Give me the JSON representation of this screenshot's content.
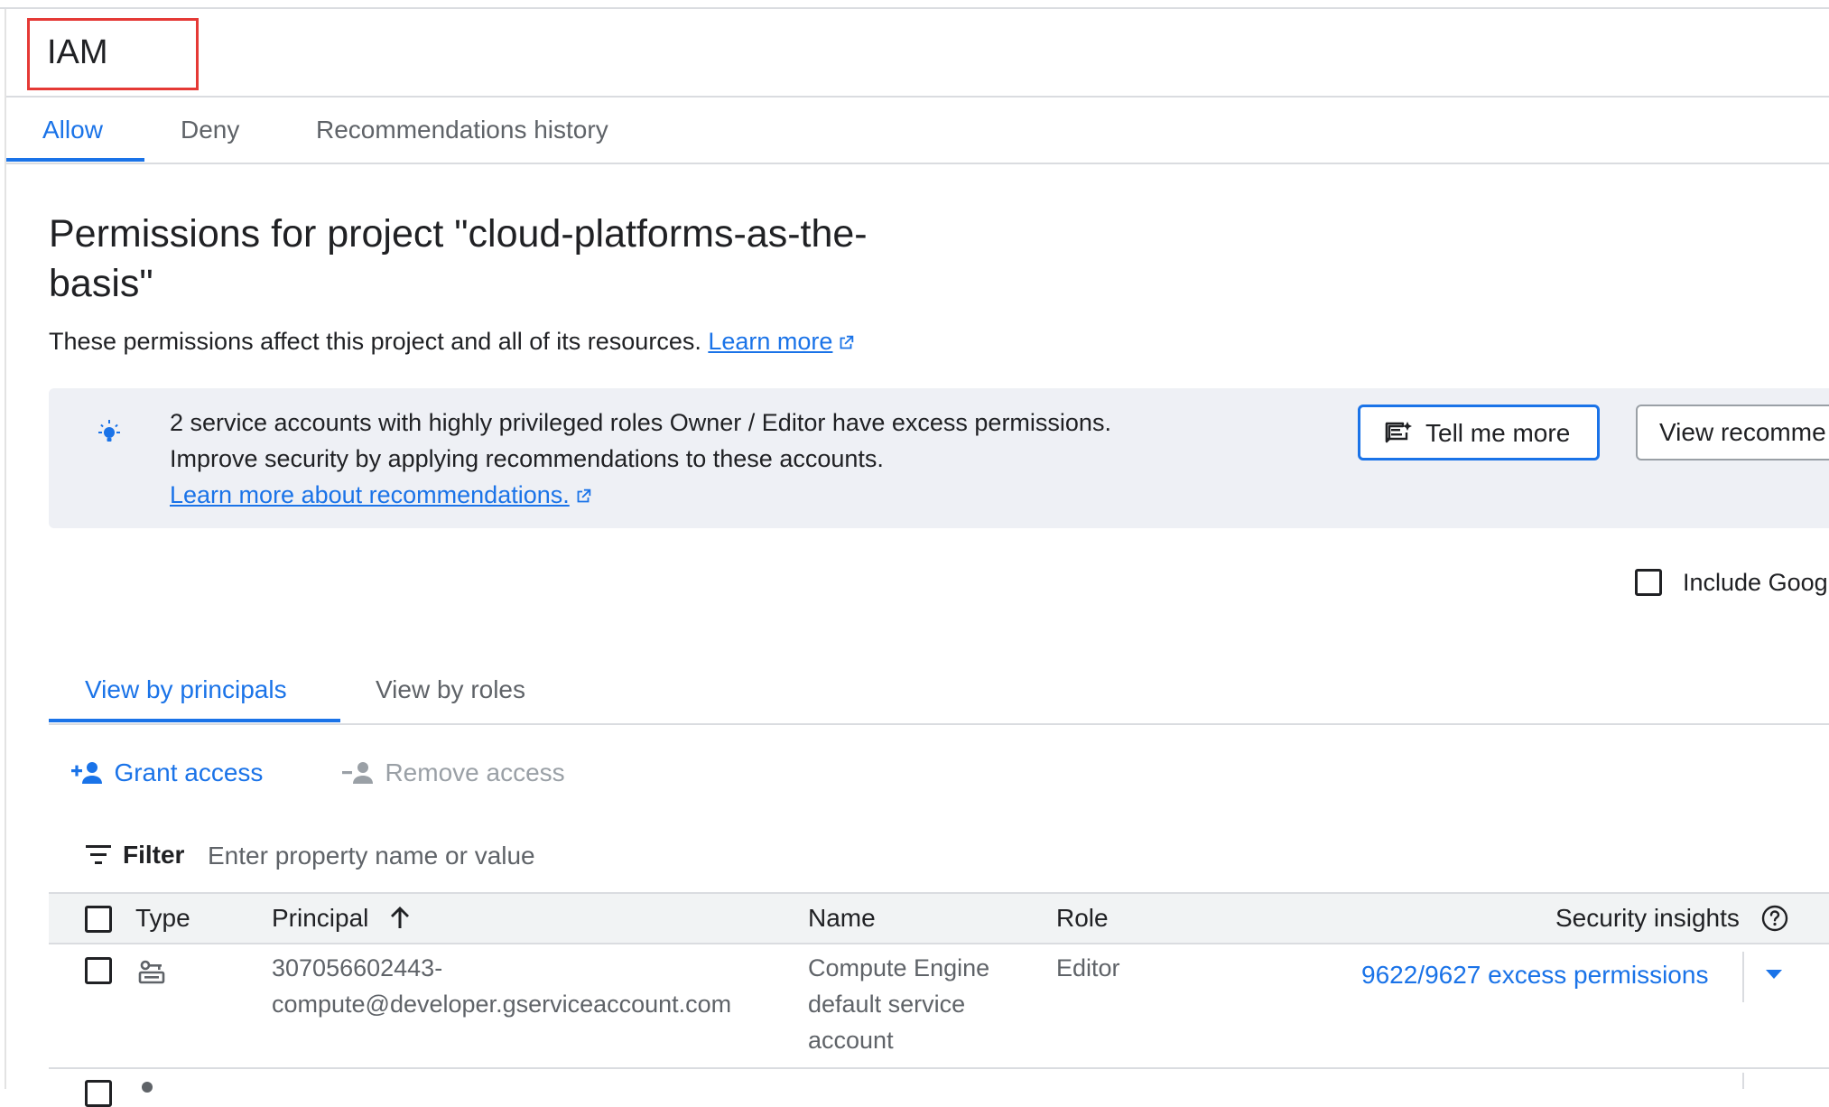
{
  "header": {
    "title": "IAM"
  },
  "tabs": [
    {
      "label": "Allow",
      "active": true
    },
    {
      "label": "Deny",
      "active": false
    },
    {
      "label": "Recommendations history",
      "active": false
    }
  ],
  "main": {
    "heading": "Permissions for project \"cloud-platforms-as-the-basis\"",
    "description": "These permissions affect this project and all of its resources.",
    "learn_more": "Learn more"
  },
  "banner": {
    "icon": "lightbulb-icon",
    "line1": "2 service accounts with highly privileged roles Owner / Editor have excess permissions.",
    "line2": "Improve security by applying recommendations to these accounts.",
    "link": "Learn more about recommendations.",
    "tell_me_more": "Tell me more",
    "view_recommendations": "View recomme"
  },
  "include_google": {
    "label": "Include Goog",
    "checked": false
  },
  "view_tabs": [
    {
      "label": "View by principals",
      "active": true
    },
    {
      "label": "View by roles",
      "active": false
    }
  ],
  "actions": {
    "grant": "Grant access",
    "remove": "Remove access"
  },
  "filter": {
    "label": "Filter",
    "placeholder": "Enter property name or value"
  },
  "table": {
    "columns": [
      "Type",
      "Principal",
      "Name",
      "Role",
      "Security insights"
    ],
    "sort_column": "Principal",
    "rows": [
      {
        "type_icon": "service-account-key-icon",
        "principal_line1": "307056602443-",
        "principal_line2": "compute@developer.gserviceaccount.com",
        "name_line1": "Compute Engine",
        "name_line2": "default service",
        "name_line3": "account",
        "role": "Editor",
        "insight": "9622/9627 excess permissions"
      }
    ]
  },
  "colors": {
    "accent": "#1a73e8",
    "highlight_box": "#e53935"
  }
}
